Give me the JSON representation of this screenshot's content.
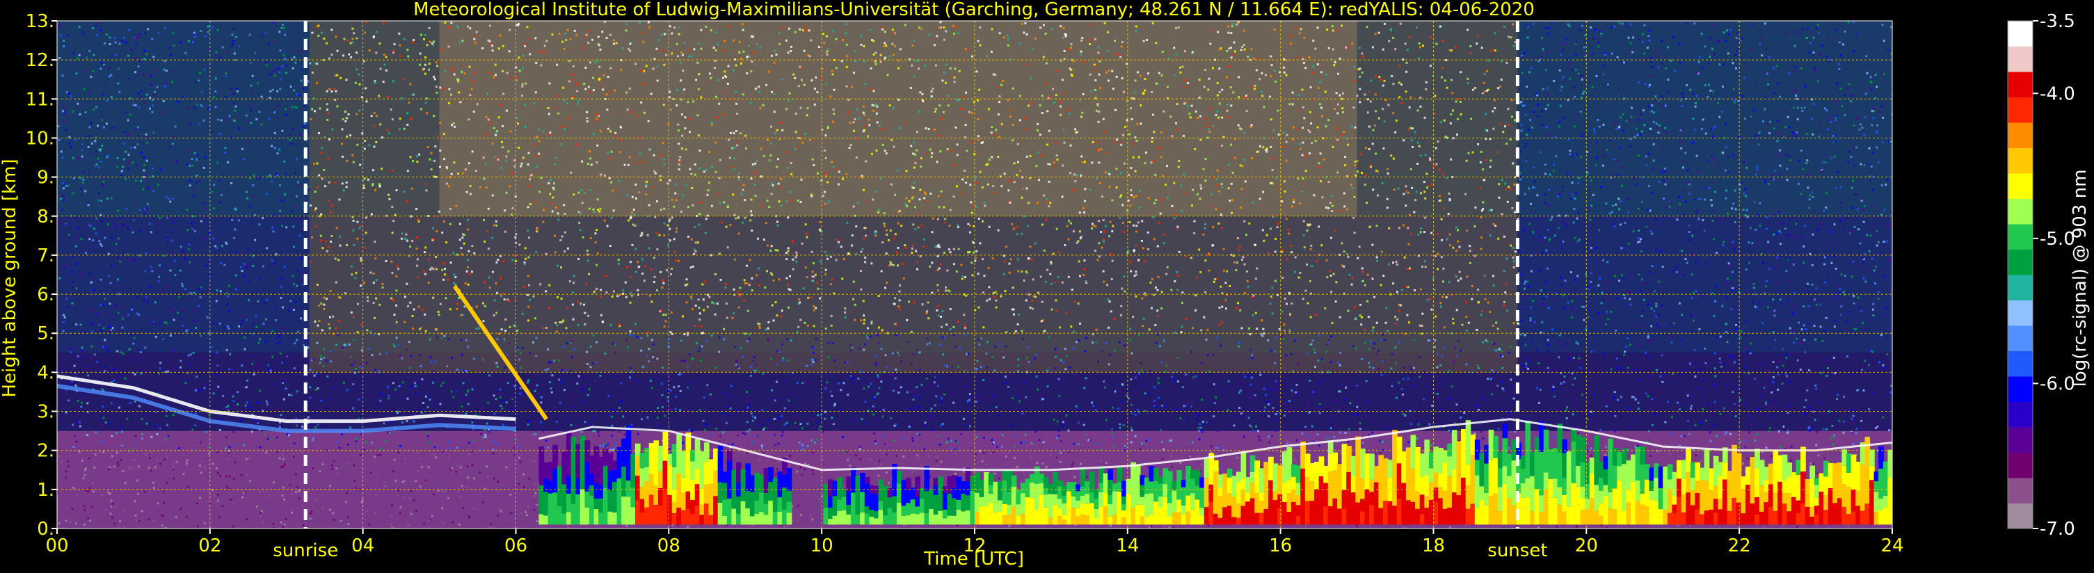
{
  "chart_data": {
    "type": "heatmap",
    "title": "Meteorological Institute of Ludwig-Maximilians-Universität (Garching, Germany; 48.261 N / 11.664 E):    redYALIS: 04-06-2020",
    "xlabel": "Time [UTC]",
    "ylabel": "Height above ground [km]",
    "xlim": [
      0,
      24
    ],
    "ylim": [
      0,
      13
    ],
    "x_ticks": [
      "00",
      "02",
      "04",
      "06",
      "08",
      "10",
      "12",
      "14",
      "16",
      "18",
      "20",
      "22",
      "24"
    ],
    "y_ticks": [
      "0.",
      "1.",
      "2.",
      "3.",
      "4.",
      "5.",
      "6.",
      "7.",
      "8.",
      "9.",
      "10.",
      "11.",
      "12.",
      "13."
    ],
    "grid": true,
    "colorbar": {
      "label": "log(rc-signal) @ 903 nm",
      "range": [
        -7.0,
        -3.5
      ],
      "tick_labels": [
        "-3.5",
        "-4.0",
        "-5.0",
        "-6.0",
        "-7.0"
      ],
      "tick_values": [
        -3.5,
        -4.0,
        -5.0,
        -6.0,
        -7.0
      ],
      "colors": [
        "#a08ca0",
        "#8c508c",
        "#700070",
        "#5a0096",
        "#2800c8",
        "#0000ff",
        "#1e5aff",
        "#5090ff",
        "#90c0ff",
        "#20b4a0",
        "#00a040",
        "#20c850",
        "#a0ff50",
        "#ffff00",
        "#ffc800",
        "#ff8c00",
        "#ff2800",
        "#e60000",
        "#f0c8c8",
        "#ffffff"
      ]
    },
    "annotations": [
      {
        "text": "sunrise",
        "x": 3.25
      },
      {
        "text": "sunset",
        "x": 19.1
      }
    ],
    "features": {
      "residual_layer_top_km": [
        {
          "t": 0.0,
          "h": 3.9
        },
        {
          "t": 1.0,
          "h": 3.6
        },
        {
          "t": 2.0,
          "h": 3.0
        },
        {
          "t": 3.0,
          "h": 2.75
        },
        {
          "t": 4.0,
          "h": 2.75
        },
        {
          "t": 5.0,
          "h": 2.9
        },
        {
          "t": 6.0,
          "h": 2.8
        }
      ],
      "mixed_layer_top_km": [
        {
          "t": 6.3,
          "h": 2.3
        },
        {
          "t": 7.0,
          "h": 2.6
        },
        {
          "t": 8.0,
          "h": 2.5
        },
        {
          "t": 9.0,
          "h": 2.0
        },
        {
          "t": 10.0,
          "h": 1.5
        },
        {
          "t": 11.0,
          "h": 1.55
        },
        {
          "t": 12.0,
          "h": 1.5
        },
        {
          "t": 13.0,
          "h": 1.5
        },
        {
          "t": 14.0,
          "h": 1.6
        },
        {
          "t": 15.0,
          "h": 1.8
        },
        {
          "t": 16.0,
          "h": 2.1
        },
        {
          "t": 17.0,
          "h": 2.3
        },
        {
          "t": 18.0,
          "h": 2.6
        },
        {
          "t": 19.0,
          "h": 2.8
        },
        {
          "t": 20.0,
          "h": 2.5
        },
        {
          "t": 21.0,
          "h": 2.1
        },
        {
          "t": 22.0,
          "h": 2.0
        },
        {
          "t": 23.0,
          "h": 2.0
        },
        {
          "t": 24.0,
          "h": 2.2
        }
      ],
      "aerosol_plume": {
        "t_start": 5.2,
        "h_start": 6.2,
        "t_end": 6.4,
        "h_end": 2.8
      }
    }
  }
}
